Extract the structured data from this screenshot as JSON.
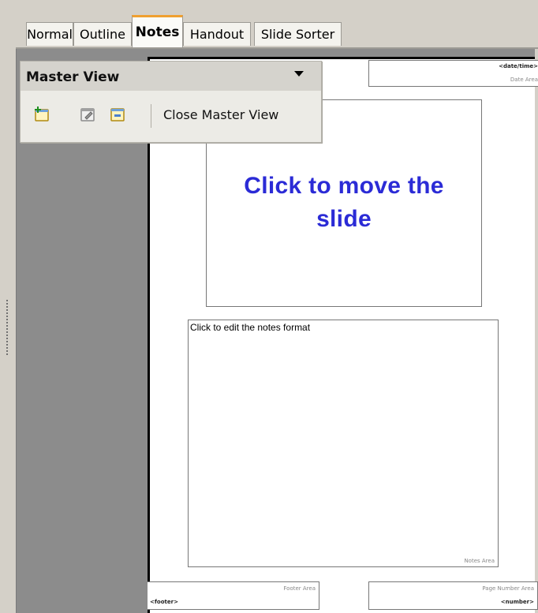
{
  "tabs": [
    {
      "label": "Normal",
      "active": false
    },
    {
      "label": "Outline",
      "active": false
    },
    {
      "label": "Notes",
      "active": true
    },
    {
      "label": "Handout",
      "active": false
    },
    {
      "label": "Slide Sorter",
      "active": false
    }
  ],
  "master_toolbar": {
    "title": "Master View",
    "icons": [
      "new-master-icon",
      "rename-master-icon",
      "delete-master-icon"
    ],
    "close_label": "Close Master View"
  },
  "page": {
    "date_field": "<date/time>",
    "date_area_label": "Date Area",
    "slide_placeholder": "Click to move the slide",
    "notes_placeholder": "Click to edit the notes format",
    "notes_area_label": "Notes Area",
    "footer_area_label": "Footer Area",
    "footer_field": "<footer>",
    "page_number_area_label": "Page Number Area",
    "number_field": "<number>"
  },
  "colors": {
    "slide_text": "#2b2bd6",
    "active_tab_accent": "#f0a030",
    "workspace": "#8c8c8c"
  }
}
